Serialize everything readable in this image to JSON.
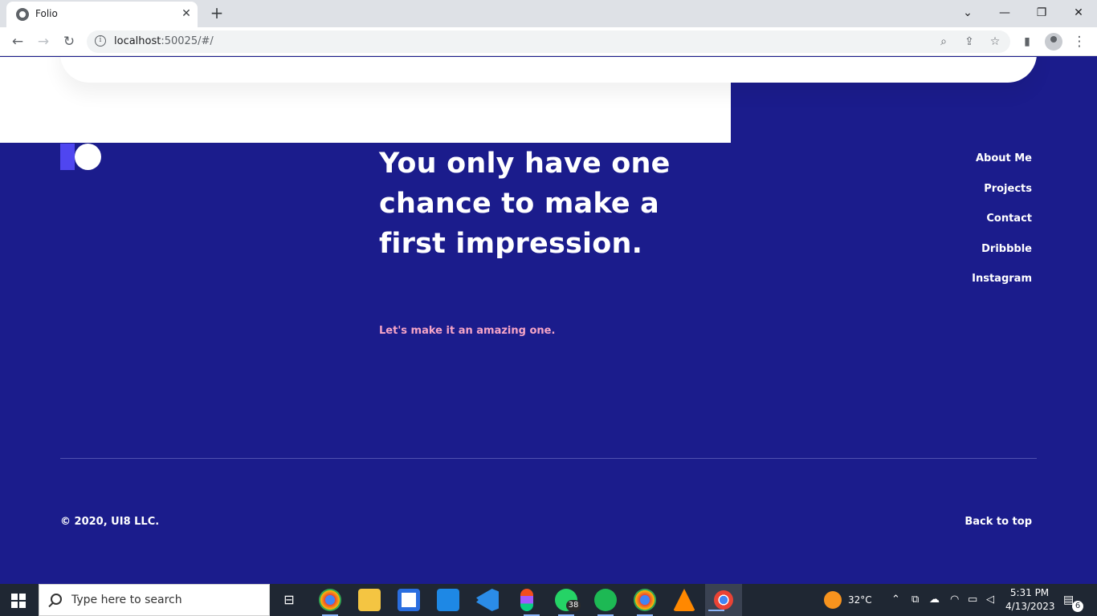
{
  "browser": {
    "tab_title": "Folio",
    "url_host": "localhost",
    "url_rest": ":50025/#/",
    "tab_close": "✕",
    "new_tab": "+"
  },
  "page": {
    "headline": "You only have one chance to make a first impression.",
    "tagline": "Let's make it an amazing one.",
    "nav": [
      "About Me",
      "Projects",
      "Contact",
      "Dribbble",
      "Instagram"
    ],
    "copyright": "© 2020, UI8 LLC.",
    "back_to_top": "Back to top"
  },
  "taskbar": {
    "search_placeholder": "Type here to search",
    "whatsapp_badge": "38",
    "weather": "32°C",
    "time": "5:31 PM",
    "date": "4/13/2023",
    "notifications": "6"
  },
  "colors": {
    "page_bg": "#1b1c8c",
    "accent_tagline": "#f6a5c7",
    "logo_bar": "#4f46f0"
  }
}
